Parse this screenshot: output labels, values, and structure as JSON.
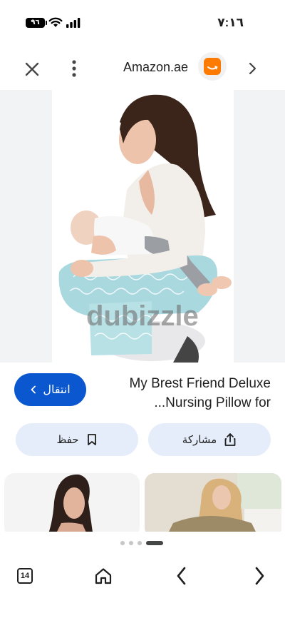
{
  "status_bar": {
    "time": "٧:١٦",
    "battery": "٩٦"
  },
  "header": {
    "site_name": "Amazon.ae"
  },
  "image": {
    "watermark": "dubizzle"
  },
  "product": {
    "title_line1": "My Brest Friend Deluxe",
    "title_line2": "...Nursing Pillow for"
  },
  "buttons": {
    "visit_label": "انتقال",
    "save_label": "حفظ",
    "share_label": "مشاركة"
  },
  "bottom_nav": {
    "tab_count": "14"
  },
  "colors": {
    "accent": "#0b57d0",
    "tonal_button": "#e5edfa",
    "site_logo": "#ff7a00"
  }
}
